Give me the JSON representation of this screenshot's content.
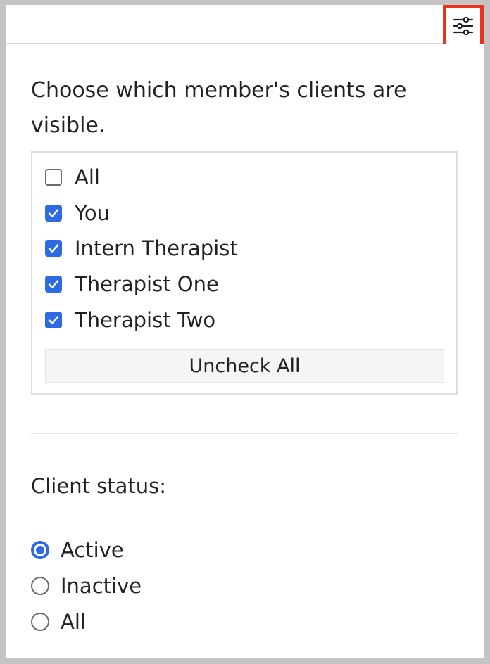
{
  "toolbar": {
    "filter_icon": "sliders-icon"
  },
  "visibility": {
    "heading": "Choose which member's clients are visible.",
    "members": [
      {
        "label": "All",
        "checked": false
      },
      {
        "label": "You",
        "checked": true
      },
      {
        "label": "Intern Therapist",
        "checked": true
      },
      {
        "label": "Therapist One",
        "checked": true
      },
      {
        "label": "Therapist Two",
        "checked": true
      }
    ],
    "uncheck_all_label": "Uncheck All"
  },
  "status": {
    "label": "Client status:",
    "options": [
      {
        "label": "Active",
        "selected": true
      },
      {
        "label": "Inactive",
        "selected": false
      },
      {
        "label": "All",
        "selected": false
      }
    ]
  },
  "colors": {
    "accent": "#2d6be4",
    "highlight": "#e8341c"
  }
}
